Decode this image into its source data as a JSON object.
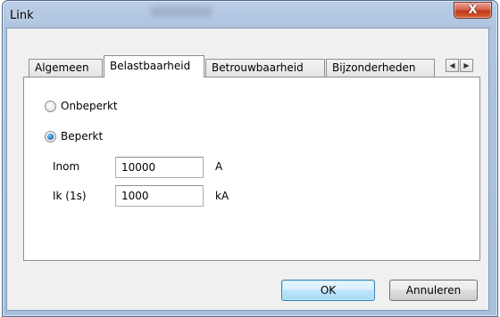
{
  "window": {
    "title": "Link",
    "close_glyph": "X"
  },
  "tabs": [
    {
      "label": "Algemeen",
      "active": false
    },
    {
      "label": "Belastbaarheid",
      "active": true
    },
    {
      "label": "Betrouwbaarheid",
      "active": false
    },
    {
      "label": "Bijzonderheden",
      "active": false
    }
  ],
  "tab_scroll": {
    "left_glyph": "◀",
    "right_glyph": "▶"
  },
  "panel": {
    "radio_unlimited": {
      "label": "Onbeperkt",
      "checked": false
    },
    "radio_limited": {
      "label": "Beperkt",
      "checked": true
    },
    "fields": [
      {
        "label": "Inom",
        "value": "10000",
        "unit": "A"
      },
      {
        "label": "Ik (1s)",
        "value": "1000",
        "unit": "kA"
      }
    ]
  },
  "buttons": {
    "ok": "OK",
    "cancel": "Annuleren"
  },
  "colors": {
    "frame": "#aec4e0",
    "close_button": "#c2381c",
    "default_button_border": "#3c7fb1"
  }
}
